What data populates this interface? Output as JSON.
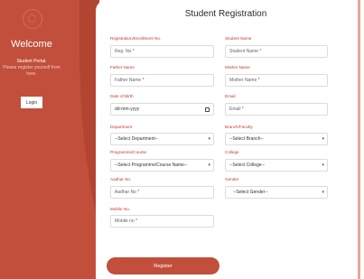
{
  "sidebar": {
    "welcome": "Welcome",
    "portal_title": "Student Portal.",
    "portal_sub": "Please register yourself from here.",
    "login_label": "Login"
  },
  "form": {
    "title": "Student Registration",
    "fields": {
      "reg_no": {
        "label": "Registration/Enrollment No.",
        "placeholder": "Reg. No *"
      },
      "student_name": {
        "label": "Student Name",
        "placeholder": "Student Name *"
      },
      "father_name": {
        "label": "Father Name",
        "placeholder": "Father Name *"
      },
      "mother_name": {
        "label": "Mother Name",
        "placeholder": "Mother Name *"
      },
      "dob": {
        "label": "Date of Birth",
        "placeholder": "dd-mm-yyyy"
      },
      "email": {
        "label": "Email",
        "placeholder": "Email *"
      },
      "department": {
        "label": "Department",
        "selected": "--Select Department--"
      },
      "branch": {
        "label": "Branch/Faculty",
        "selected": "--Select Branch--"
      },
      "programme": {
        "label": "Programme/Course",
        "selected": "--Select Programme/Course Name--"
      },
      "college": {
        "label": "College",
        "selected": "--Select College--"
      },
      "aadhar": {
        "label": "Aadhar No.",
        "placeholder": "Aadhar No *"
      },
      "gender": {
        "label": "Gender",
        "selected": "--Select Gender--"
      },
      "mobile": {
        "label": "Mobile No.",
        "placeholder": "Mobile no *"
      }
    },
    "register_label": "Register"
  },
  "colors": {
    "brand": "#c14f3b",
    "brand_dark": "#b24532",
    "label": "#c0392b"
  }
}
